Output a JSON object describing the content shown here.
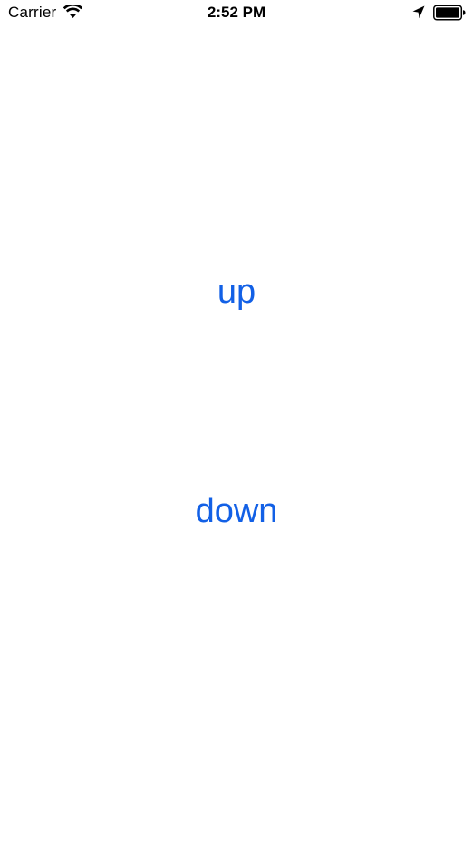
{
  "status_bar": {
    "carrier": "Carrier",
    "time": "2:52 PM",
    "icons": [
      "wifi-icon",
      "location-arrow-icon",
      "battery-icon"
    ]
  },
  "main": {
    "up_label": "up",
    "down_label": "down"
  },
  "colors": {
    "button_text": "#1260e6",
    "background": "#ffffff",
    "status_text": "#000000"
  }
}
